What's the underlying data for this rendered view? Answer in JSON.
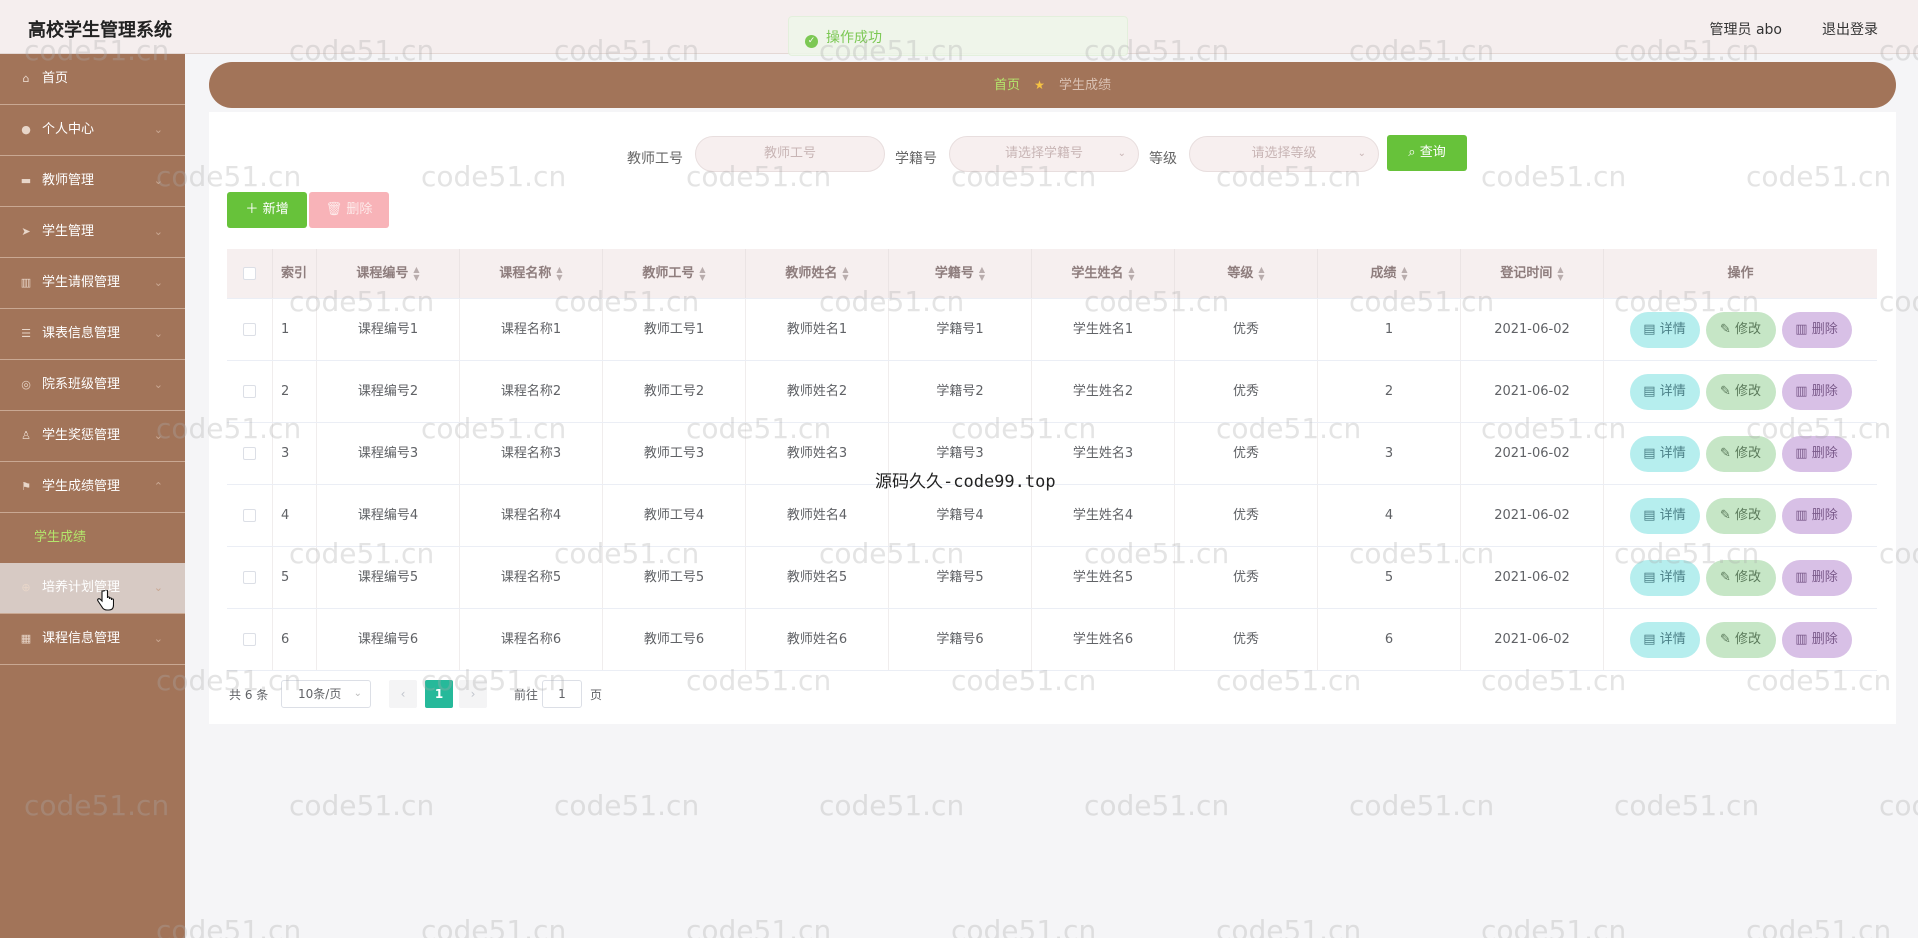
{
  "app": {
    "title": "高校学生管理系统"
  },
  "header": {
    "user": "管理员 abo",
    "logout": "退出登录"
  },
  "toast": {
    "message": "操作成功"
  },
  "sidebar": {
    "items": [
      {
        "label": "首页",
        "icon": "home-icon"
      },
      {
        "label": "个人中心",
        "icon": "user-icon"
      },
      {
        "label": "教师管理",
        "icon": "car-icon"
      },
      {
        "label": "学生管理",
        "icon": "send-icon"
      },
      {
        "label": "学生请假管理",
        "icon": "chart-icon"
      },
      {
        "label": "课表信息管理",
        "icon": "list-icon"
      },
      {
        "label": "院系班级管理",
        "icon": "circle-icon"
      },
      {
        "label": "学生奖惩管理",
        "icon": "trophy-icon"
      },
      {
        "label": "学生成绩管理",
        "icon": "flag-icon"
      },
      {
        "label": "学生成绩",
        "sub": true
      },
      {
        "label": "培养计划管理",
        "icon": "globe-icon"
      },
      {
        "label": "课程信息管理",
        "icon": "grid-icon"
      }
    ]
  },
  "breadcrumb": {
    "home": "首页",
    "current": "学生成绩"
  },
  "search": {
    "teacher_label": "教师工号",
    "teacher_placeholder": "教师工号",
    "student_label": "学籍号",
    "student_placeholder": "请选择学籍号",
    "grade_label": "等级",
    "grade_placeholder": "请选择等级",
    "query": "查询"
  },
  "actions": {
    "add": "新增",
    "delete": "删除"
  },
  "table": {
    "headers": [
      "索引",
      "课程编号",
      "课程名称",
      "教师工号",
      "教师姓名",
      "学籍号",
      "学生姓名",
      "等级",
      "成绩",
      "登记时间",
      "操作"
    ],
    "rows": [
      [
        "1",
        "课程编号1",
        "课程名称1",
        "教师工号1",
        "教师姓名1",
        "学籍号1",
        "学生姓名1",
        "优秀",
        "1",
        "2021-06-02"
      ],
      [
        "2",
        "课程编号2",
        "课程名称2",
        "教师工号2",
        "教师姓名2",
        "学籍号2",
        "学生姓名2",
        "优秀",
        "2",
        "2021-06-02"
      ],
      [
        "3",
        "课程编号3",
        "课程名称3",
        "教师工号3",
        "教师姓名3",
        "学籍号3",
        "学生姓名3",
        "优秀",
        "3",
        "2021-06-02"
      ],
      [
        "4",
        "课程编号4",
        "课程名称4",
        "教师工号4",
        "教师姓名4",
        "学籍号4",
        "学生姓名4",
        "优秀",
        "4",
        "2021-06-02"
      ],
      [
        "5",
        "课程编号5",
        "课程名称5",
        "教师工号5",
        "教师姓名5",
        "学籍号5",
        "学生姓名5",
        "优秀",
        "5",
        "2021-06-02"
      ],
      [
        "6",
        "课程编号6",
        "课程名称6",
        "教师工号6",
        "教师姓名6",
        "学籍号6",
        "学生姓名6",
        "优秀",
        "6",
        "2021-06-02"
      ]
    ],
    "row_actions": {
      "detail": "详情",
      "edit": "修改",
      "remove": "删除"
    }
  },
  "pagination": {
    "total": "共 6 条",
    "page_size": "10条/页",
    "current": "1",
    "goto": "前往",
    "goto_value": "1",
    "unit": "页"
  },
  "watermark": {
    "text": "code51.cn",
    "center": "源码久久-code99.top"
  },
  "colors": {
    "sidebar": "#a27459",
    "accent_green": "#67c23a",
    "pager_active": "#26b99a"
  }
}
